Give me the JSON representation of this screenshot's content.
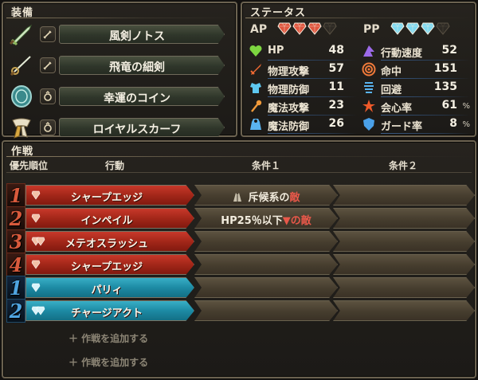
{
  "equipment": {
    "title": "装備",
    "items": [
      {
        "name": "風剣ノトス",
        "icon": "sword-icon",
        "slot_icon": "sword-slot-icon"
      },
      {
        "name": "飛竜の細剣",
        "icon": "rapier-icon",
        "slot_icon": "sword-slot-icon"
      },
      {
        "name": "幸運のコイン",
        "icon": "coin-icon",
        "slot_icon": "ring-slot-icon"
      },
      {
        "name": "ロイヤルスカーフ",
        "icon": "scarf-icon",
        "slot_icon": "ring-slot-icon"
      }
    ]
  },
  "status": {
    "title": "ステータス",
    "ap_label": "AP",
    "pp_label": "PP",
    "ap_gems": {
      "filled": 3,
      "total": 4,
      "color": "#e0563e"
    },
    "pp_gems": {
      "filled": 3,
      "total": 4,
      "color": "#7fd9f0"
    },
    "stats_left": [
      {
        "name": "HP",
        "value": "48",
        "unit": "",
        "icon": "heart-icon",
        "color": "#7dd640"
      },
      {
        "name": "物理攻撃",
        "value": "57",
        "unit": "",
        "icon": "sword-icon",
        "color": "#f06a32"
      },
      {
        "name": "物理防御",
        "value": "11",
        "unit": "",
        "icon": "armor-icon",
        "color": "#5ec8f0"
      },
      {
        "name": "魔法攻撃",
        "value": "23",
        "unit": "",
        "icon": "wand-icon",
        "color": "#f09a3a"
      },
      {
        "name": "魔法防御",
        "value": "26",
        "unit": "",
        "icon": "robe-icon",
        "color": "#5ab4f0"
      }
    ],
    "stats_right": [
      {
        "name": "行動速度",
        "value": "52",
        "unit": "",
        "icon": "speed-icon",
        "color": "#9c6ae8"
      },
      {
        "name": "命中",
        "value": "151",
        "unit": "",
        "icon": "target-icon",
        "color": "#f07a3a"
      },
      {
        "name": "回避",
        "value": "135",
        "unit": "",
        "icon": "evade-icon",
        "color": "#5ab4f0"
      },
      {
        "name": "会心率",
        "value": "61",
        "unit": "%",
        "icon": "crit-icon",
        "color": "#f05a2a"
      },
      {
        "name": "ガード率",
        "value": "8",
        "unit": "%",
        "icon": "shield-icon",
        "color": "#4aa0e8"
      }
    ]
  },
  "tactics": {
    "title": "作戦",
    "headers": {
      "priority": "優先順位",
      "action": "行動",
      "cond1": "条件１",
      "cond2": "条件２"
    },
    "rows": [
      {
        "num": "1",
        "kind": "red",
        "action": "シャープエッジ",
        "gems": 1,
        "cond1_pre": "斥候系の",
        "cond1_post": "敵",
        "cond1_icon": "scout-icon",
        "cond2": ""
      },
      {
        "num": "2",
        "kind": "red",
        "action": "インペイル",
        "gems": 1,
        "cond1_pre": "HP25％以下",
        "cond1_mid": "▼",
        "cond1_post": "の敵",
        "cond1_icon": "",
        "cond2": ""
      },
      {
        "num": "3",
        "kind": "red",
        "action": "メテオスラッシュ",
        "gems": 2,
        "cond1_pre": "",
        "cond1_post": "",
        "cond1_icon": "",
        "cond2": ""
      },
      {
        "num": "4",
        "kind": "red",
        "action": "シャープエッジ",
        "gems": 1,
        "cond1_pre": "",
        "cond1_post": "",
        "cond1_icon": "",
        "cond2": ""
      },
      {
        "num": "1",
        "kind": "blue",
        "action": "パリィ",
        "gems": 1,
        "cond1_pre": "",
        "cond1_post": "",
        "cond1_icon": "",
        "cond2": ""
      },
      {
        "num": "2",
        "kind": "blue",
        "action": "チャージアクト",
        "gems": 2,
        "cond1_pre": "",
        "cond1_post": "",
        "cond1_icon": "",
        "cond2": ""
      }
    ],
    "add_label": "＋ 作戦を追加する",
    "add_label_2": "＋ 作戦を追加する"
  }
}
